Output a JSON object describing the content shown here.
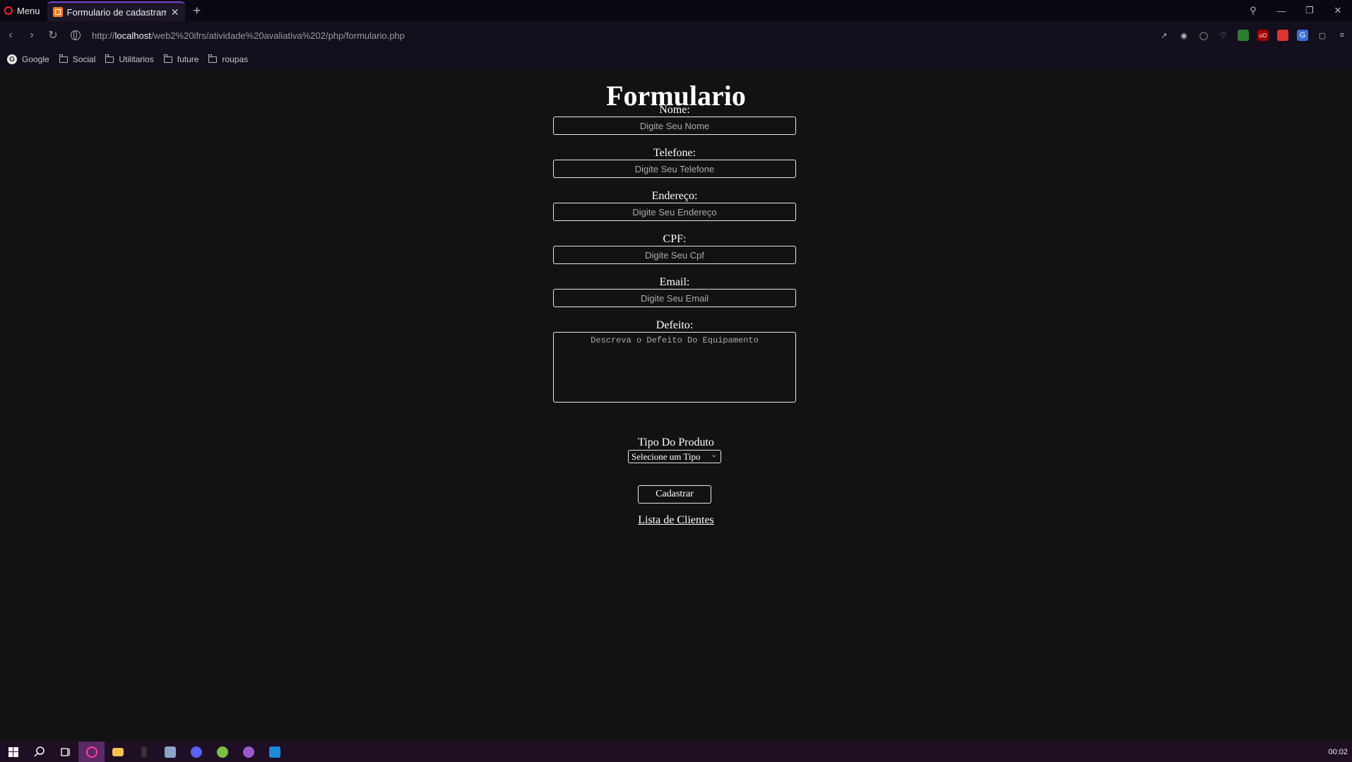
{
  "browser": {
    "menu_label": "Menu",
    "tab_title": "Formulario de cadastramento",
    "tab_close": "✕",
    "new_tab": "+",
    "url_prefix": "http://",
    "url_host": "localhost",
    "url_path": "/web2%20ifrs/atividade%20avaliativa%202/php/formulario.php",
    "accent_color": "#7a3fd6"
  },
  "bookmarks": [
    {
      "label": "Google",
      "icon": "google-icon"
    },
    {
      "label": "Social",
      "icon": "folder-icon"
    },
    {
      "label": "Utilitarios",
      "icon": "folder-icon"
    },
    {
      "label": "future",
      "icon": "folder-icon"
    },
    {
      "label": "roupas",
      "icon": "folder-icon"
    }
  ],
  "form": {
    "title": "Formulario",
    "fields": [
      {
        "label": "Nome:",
        "placeholder": "Digite Seu Nome"
      },
      {
        "label": "Telefone:",
        "placeholder": "Digite Seu Telefone"
      },
      {
        "label": "Endereço:",
        "placeholder": "Digite Seu Endereço"
      },
      {
        "label": "CPF:",
        "placeholder": "Digite Seu Cpf"
      },
      {
        "label": "Email:",
        "placeholder": "Digite Seu Email"
      }
    ],
    "defect": {
      "label": "Defeito:",
      "placeholder": "Descreva o Defeito Do Equipamento"
    },
    "product_type": {
      "label": "Tipo Do Produto",
      "selected": "Selecione um Tipo"
    },
    "submit_label": "Cadastrar",
    "clients_link": "Lista de Clientes"
  },
  "taskbar": {
    "clock": "00:02"
  }
}
